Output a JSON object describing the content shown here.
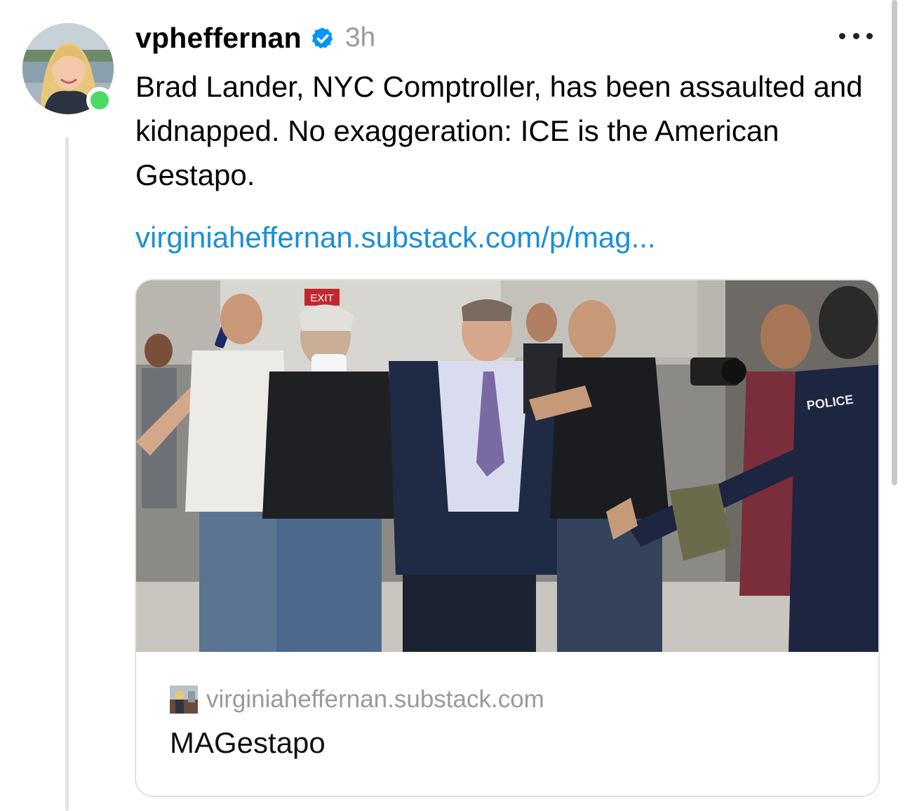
{
  "post": {
    "username": "vpheffernan",
    "time": "3h",
    "text": "Brad Lander, NYC Comptroller, has been assaulted and kidnapped. No exaggeration: ICE is the American Gestapo.",
    "link": "virginiaheffernan.substack.com/p/mag..."
  },
  "icons": {
    "verified": "verified-badge-icon",
    "more": "more-horizontal-icon",
    "online": "online-status-icon"
  },
  "card": {
    "domain": "virginiaheffernan.substack.com",
    "title": "MAGestapo",
    "image_sign_exit": "EXIT",
    "image_jacket_text": "POLICE"
  },
  "colors": {
    "link": "#1a8fd6",
    "verified": "#0095f6",
    "online": "#4cd964",
    "muted": "#9a9a9a"
  }
}
